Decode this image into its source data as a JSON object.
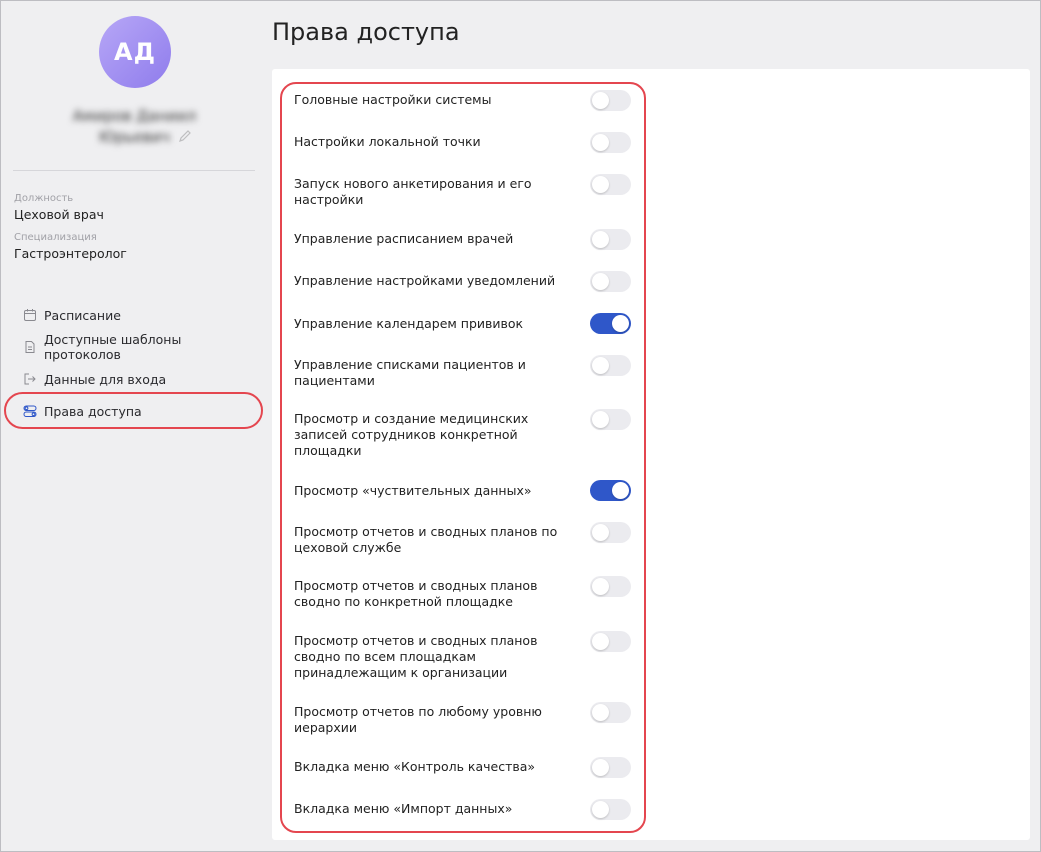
{
  "profile": {
    "initials": "АД",
    "name": "Амиров Даниил Юрьевич",
    "position_label": "Должность",
    "position_value": "Цеховой врач",
    "specialization_label": "Специализация",
    "specialization_value": "Гастроэнтеролог"
  },
  "nav": {
    "items": [
      {
        "label": "Расписание",
        "icon": "calendar-icon"
      },
      {
        "label": "Доступные шаблоны протоколов",
        "icon": "document-icon"
      },
      {
        "label": "Данные для входа",
        "icon": "login-icon"
      },
      {
        "label": "Права доступа",
        "icon": "toggles-icon",
        "active": true
      }
    ]
  },
  "page": {
    "title": "Права доступа"
  },
  "permissions": [
    {
      "label": "Головные настройки системы",
      "enabled": false
    },
    {
      "label": "Настройки локальной точки",
      "enabled": false
    },
    {
      "label": "Запуск нового анкетирования и его настройки",
      "enabled": false
    },
    {
      "label": "Управление расписанием врачей",
      "enabled": false
    },
    {
      "label": "Управление настройками уведомлений",
      "enabled": false
    },
    {
      "label": "Управление календарем прививок",
      "enabled": true
    },
    {
      "label": "Управление списками пациентов и пациентами",
      "enabled": false
    },
    {
      "label": "Просмотр и создание медицинских записей сотрудников конкретной площадки",
      "enabled": false
    },
    {
      "label": "Просмотр «чуствительных данных»",
      "enabled": true
    },
    {
      "label": "Просмотр отчетов и сводных планов по цеховой службе",
      "enabled": false
    },
    {
      "label": "Просмотр отчетов и сводных планов сводно по конкретной площадке",
      "enabled": false
    },
    {
      "label": " Просмотр отчетов и сводных планов сводно по всем площадкам принадлежащим к организации",
      "enabled": false
    },
    {
      "label": "Просмотр отчетов по любому уровню иерархии",
      "enabled": false
    },
    {
      "label": "Вкладка меню «Контроль качества»",
      "enabled": false
    },
    {
      "label": "Вкладка меню «Импорт данных»",
      "enabled": false
    }
  ],
  "colors": {
    "accent": "#2f57c9",
    "highlight": "#e4464f",
    "avatar": "#9b88f0"
  }
}
